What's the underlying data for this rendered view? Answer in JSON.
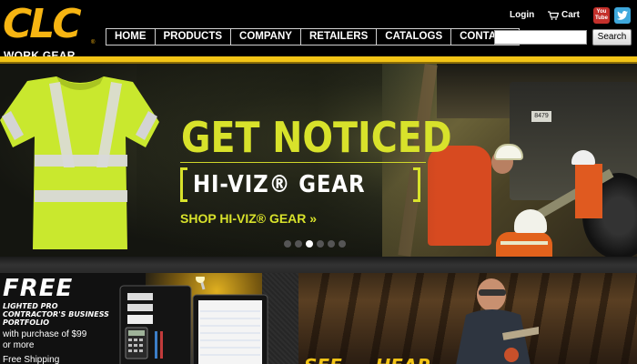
{
  "brand": {
    "logo_letters": "CLC",
    "logo_tm": "®",
    "logo_subtitle": "WORK GEAR",
    "brand_color": "#f7b512"
  },
  "header": {
    "login_label": "Login",
    "cart_label": "Cart",
    "search": {
      "value": "",
      "button_label": "Search"
    },
    "social": {
      "youtube_line1": "You",
      "youtube_line2": "Tube",
      "youtube_icon": "youtube-icon",
      "twitter_icon": "twitter-icon"
    }
  },
  "nav": {
    "items": [
      {
        "label": "HOME"
      },
      {
        "label": "PRODUCTS"
      },
      {
        "label": "COMPANY"
      },
      {
        "label": "RETAILERS"
      },
      {
        "label": "CATALOGS"
      },
      {
        "label": "CONTACT"
      }
    ]
  },
  "hero": {
    "headline": "GET NOTICED",
    "product_line": "HI-VIZ® GEAR",
    "cta": "SHOP HI-VIZ® GEAR »",
    "plate_text": "8479",
    "accent_color": "#d8e22b",
    "slides_total": 6,
    "active_slide": 3
  },
  "promos": {
    "portfolio": {
      "headline": "FREE",
      "subhead": "LIGHTED PRO CONTRACTOR'S BUSINESS PORTFOLIO",
      "offer": "with purchase of $99 or more",
      "shipping": "Free Shipping"
    },
    "plumbing": {
      "headline": "SEE ... HEAR"
    }
  },
  "colors": {
    "header_bar": "#f3c416",
    "background": "#000000"
  }
}
